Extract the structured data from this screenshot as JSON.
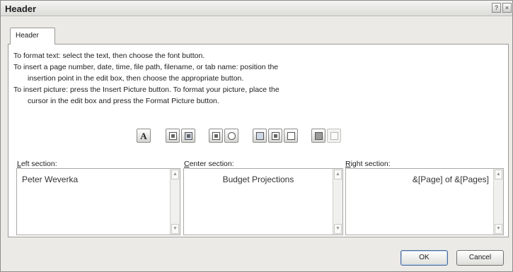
{
  "window": {
    "title": "Header",
    "help_icon": "?",
    "close_icon": "×"
  },
  "tabs": [
    {
      "label": "Header"
    }
  ],
  "instructions": [
    "To format text:  select the text, then choose the font button.",
    "To insert a page number, date, time, file path, filename, or tab name:  position the",
    "insertion point in the edit box, then choose the appropriate button.",
    "To insert picture: press the Insert Picture button.  To format your picture, place the",
    "cursor in the edit box and press the Format Picture button."
  ],
  "toolbar": [
    "format-text-icon",
    "page-number-icon",
    "number-of-pages-icon",
    "date-icon",
    "time-icon",
    "file-path-icon",
    "filename-icon",
    "sheet-name-icon",
    "insert-picture-icon",
    "format-picture-icon"
  ],
  "toolbar_letter": "A",
  "sections": {
    "left": {
      "label_accel": "L",
      "label_rest": "eft section:",
      "value": "Peter Weverka"
    },
    "center": {
      "label_accel": "C",
      "label_rest": "enter section:",
      "value": "Budget Projections"
    },
    "right": {
      "label_accel": "R",
      "label_rest": "ight section:",
      "value": "&[Page] of &[Pages]"
    }
  },
  "buttons": {
    "ok": "OK",
    "cancel": "Cancel"
  },
  "scroll_up": "▲",
  "scroll_down": "▼"
}
